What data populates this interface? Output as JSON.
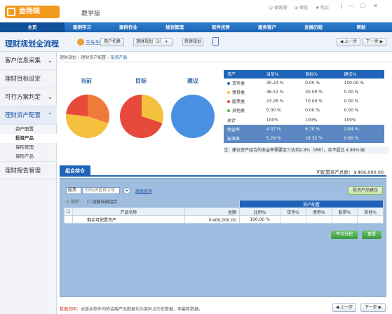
{
  "app": {
    "logo_text": "金扬规",
    "edition": "教学版"
  },
  "top_commands": [
    {
      "label": "微客服"
    },
    {
      "label": "微信"
    },
    {
      "label": "购买"
    }
  ],
  "window_controls": [
    "|",
    "—",
    "☐",
    "✕"
  ],
  "main_nav": [
    "主页",
    "案例学习",
    "案例作业",
    "规划管理",
    "软件优势",
    "服务客户",
    "发展历程",
    "帮助"
  ],
  "subbar": {
    "title": "理财规划全流程",
    "user": "王先生",
    "switch_user": "用户切换",
    "plan_select": "理财规划（2）",
    "new_plan": "新建规划",
    "prev": "上一步",
    "next": "下一步"
  },
  "sidebar": {
    "items": [
      {
        "label": "客户信息采集",
        "arrow": "⌄"
      },
      {
        "label": "理财目标设定",
        "arrow": ""
      },
      {
        "label": "可行方案判定",
        "arrow": "⌄"
      },
      {
        "label": "理财资产配置",
        "arrow": "⌃"
      },
      {
        "label": "理财报告管理",
        "arrow": ""
      }
    ],
    "subitems": [
      "资产配置",
      "投资产品",
      "保险管理",
      "保险产品"
    ]
  },
  "breadcrumb": [
    "理财规划",
    "理财资产配置",
    "投资产品"
  ],
  "pies": {
    "labels": [
      "当前",
      "目标",
      "建议"
    ],
    "colors": {
      "cash": "#f4c13f",
      "bond": "#f07a3a",
      "stock": "#e7493b",
      "other": "#4a90e2"
    }
  },
  "allocation": {
    "headers": [
      "资产",
      "当前%",
      "目标%",
      "建议%"
    ],
    "rows": [
      {
        "name": "货币类",
        "color": "#2a6db8",
        "current": "30.23 %",
        "target": "0.00 %",
        "suggest": "100.00 %"
      },
      {
        "name": "债券类",
        "color": "#f4c13f",
        "current": "46.51 %",
        "target": "30.00 %",
        "suggest": "0.00 %"
      },
      {
        "name": "股票类",
        "color": "#e7493b",
        "current": "23.26 %",
        "target": "70.00 %",
        "suggest": "0.00 %"
      },
      {
        "name": "其他类",
        "color": "#4caf50",
        "current": "0.00 %",
        "target": "0.00 %",
        "suggest": "0.00 %"
      }
    ],
    "total": {
      "name": "总计",
      "current": "100%",
      "target": "100%",
      "suggest": "100%"
    },
    "rate": {
      "name": "收益率",
      "current": "4.37 %",
      "target": "6.70 %",
      "suggest": "2.84 %"
    },
    "std": {
      "name": "标准差",
      "current": "5.29 %",
      "target": "16.32 %",
      "suggest": "0.60 %"
    }
  },
  "note": "注：建议资产组合的收益率需要至少达到2.8%（IRR），且不超过 4.86%(标",
  "portfolio": {
    "tab": "组合持仓",
    "available": "可配置资产总额：￥406,000.00",
    "filter": "股票",
    "search_placeholder": "代码|拼音首字母",
    "add": "+",
    "adv_query": "高级查询",
    "delete": "删除",
    "join": "加载当前组合",
    "product_advice": "投资产品建议",
    "alloc_header": "资产配置",
    "columns": [
      "产品名称",
      "金额",
      "比例%",
      "货币%",
      "债券%",
      "股票%",
      "其他%"
    ],
    "row": {
      "name": "剩余可配置资产",
      "amount": "￥406,000.00",
      "ratio": "100.00 %"
    },
    "avg_btn": "平均分配",
    "reset_btn": "重置"
  },
  "footer": {
    "note_label": "数据说明：",
    "note": "本版本软件内的金融产品数据均为某时点历史数据，非最新数据。",
    "prev": "上一步",
    "next": "下一步"
  }
}
